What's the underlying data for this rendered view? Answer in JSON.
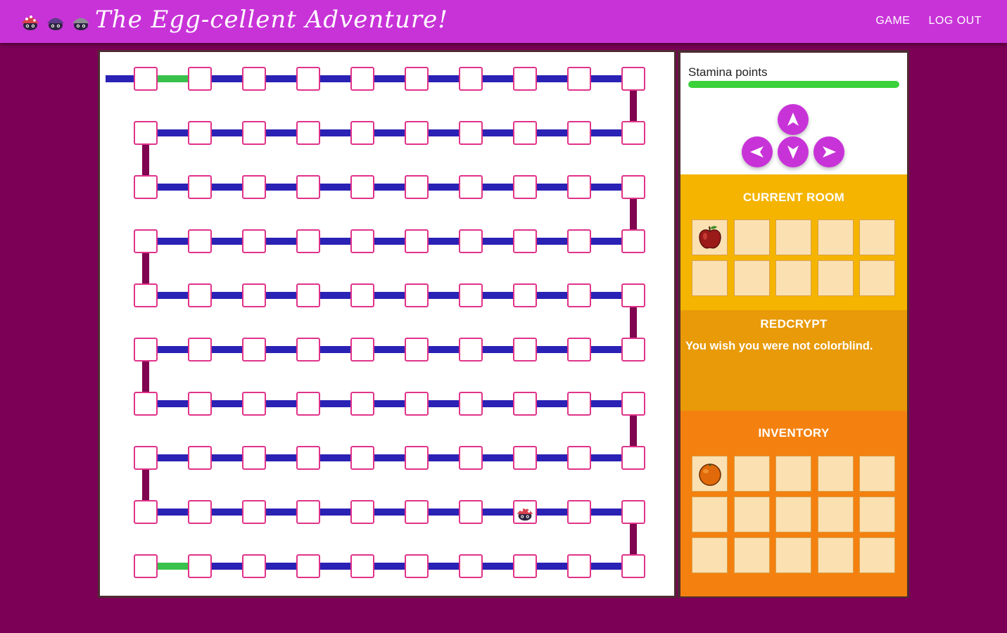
{
  "app": {
    "title": "The Egg-cellent Adventure!",
    "logo_icons": [
      "red-beetle-icon",
      "purple-beetle-icon",
      "gray-beetle-icon"
    ]
  },
  "nav": {
    "game_label": "GAME",
    "logout_label": "LOG OUT"
  },
  "maze": {
    "rows": 10,
    "cols": 10,
    "player": {
      "row": 9,
      "col": 8
    },
    "open_gaps": [
      {
        "row": 1,
        "col": 1
      },
      {
        "row": 10,
        "col": 1
      }
    ],
    "entry_row": 1,
    "colors": {
      "wall": "#2a21b5",
      "open": "#38c24c",
      "link": "#80044f",
      "cell_border": "#e0338a"
    }
  },
  "stamina": {
    "label": "Stamina points",
    "value": 1.0
  },
  "controls": {
    "up": "▲",
    "left": "◀",
    "down": "▼",
    "right": "▶"
  },
  "current_room": {
    "title": "CURRENT ROOM",
    "slots": [
      "apple",
      "",
      "",
      "",
      "",
      "",
      "",
      "",
      "",
      ""
    ]
  },
  "room_info": {
    "title": "REDCRYPT",
    "message": "You wish you were not colorblind."
  },
  "inventory": {
    "title": "INVENTORY",
    "slots": [
      "orange",
      "",
      "",
      "",
      "",
      "",
      "",
      "",
      "",
      "",
      "",
      "",
      "",
      "",
      ""
    ]
  },
  "theme": {
    "page": "#7c0156",
    "topbar": "#c833d8",
    "room": "#f4b400",
    "message": "#e89a08",
    "inventory": "#f4810f",
    "slot": "#fbe0b1"
  }
}
